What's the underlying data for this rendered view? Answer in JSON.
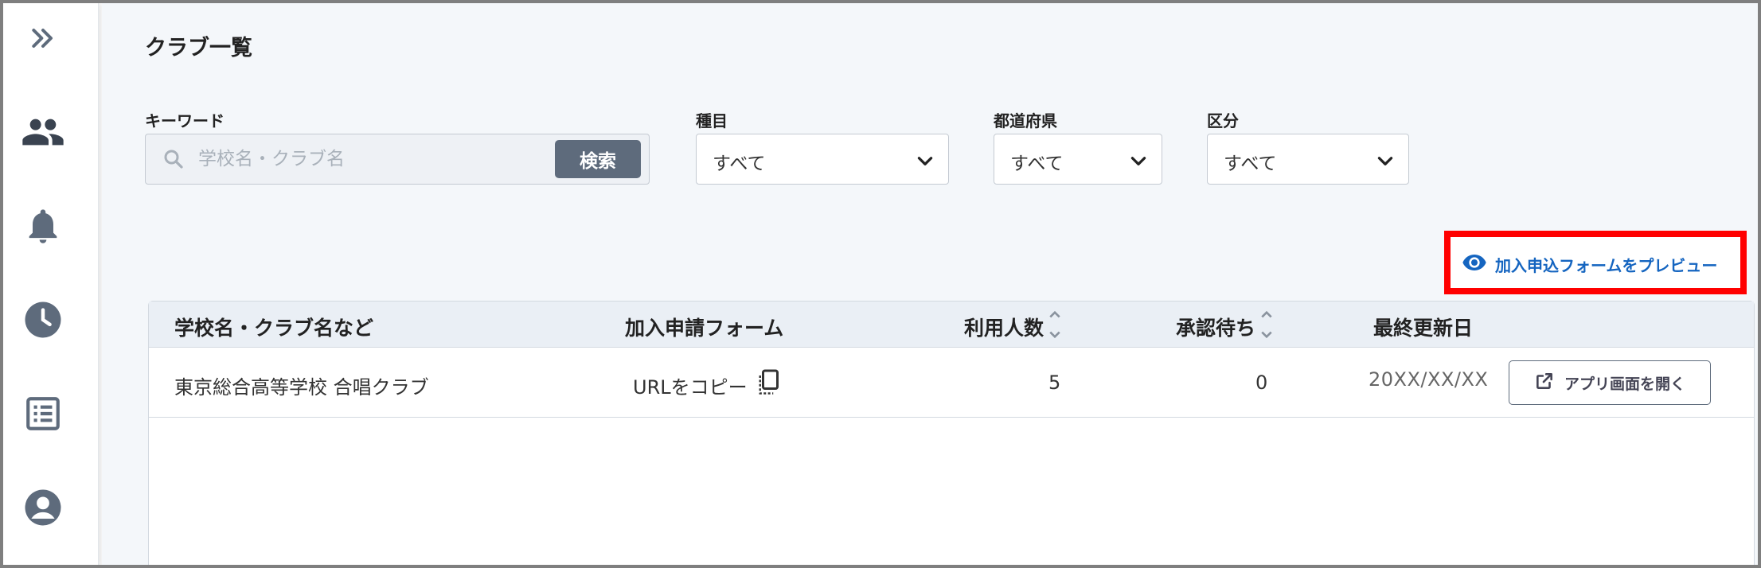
{
  "page": {
    "title": "クラブ一覧"
  },
  "sidebar": {
    "icons": [
      "chevron-double-right-icon",
      "people-icon",
      "bell-icon",
      "clock-icon",
      "list-icon",
      "account-icon"
    ]
  },
  "filters": {
    "keyword": {
      "label": "キーワード",
      "placeholder": "学校名・クラブ名",
      "value": "",
      "button": "検索"
    },
    "sport": {
      "label": "種目",
      "value": "すべて"
    },
    "prefecture": {
      "label": "都道府県",
      "value": "すべて"
    },
    "division": {
      "label": "区分",
      "value": "すべて"
    }
  },
  "preview_link": {
    "label": "加入申込フォームをプレビュー",
    "highlight_color": "#ff0000"
  },
  "table": {
    "headers": {
      "name": "学校名・クラブ名など",
      "form": "加入申請フォーム",
      "members": "利用人数",
      "pending": "承認待ち",
      "updated": "最終更新日"
    },
    "rows": [
      {
        "name": "東京総合高等学校 合唱クラブ",
        "form": "URLをコピー",
        "members": "5",
        "pending": "0",
        "updated": "20XX/XX/XX",
        "action": "アプリ画面を開く"
      }
    ]
  },
  "colors": {
    "accent": "#1565c0",
    "button": "#5e6b7c",
    "sidebar_icon": "#5e6b7c",
    "background": "#f4f7fa"
  }
}
